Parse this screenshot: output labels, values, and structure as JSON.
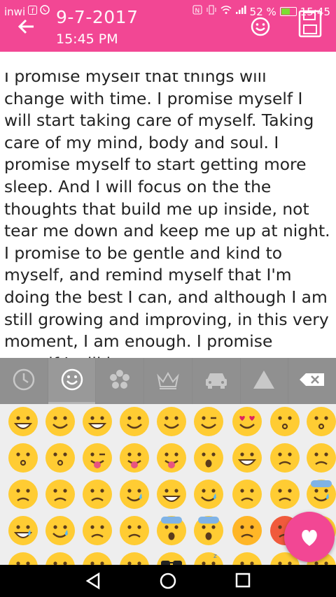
{
  "status_bar": {
    "carrier": "inwi",
    "battery": "52 %",
    "time": "15:45",
    "icons": [
      "facebook-icon",
      "whatsapp-icon",
      "nfc-icon",
      "vibrate-icon",
      "wifi-icon",
      "signal-icon",
      "battery-icon"
    ]
  },
  "header": {
    "date": "9-7-2017",
    "time": "15:45 PM",
    "back_icon": "back-arrow-icon",
    "emoji_icon": "smiley-icon",
    "save_icon": "save-icon",
    "color": "#f24794"
  },
  "note": {
    "text": "I promise myself that things will change with time. I promise myself I will start taking care of myself. Taking care of my mind, body and soul. I promise myself to start getting more sleep. And I will focus on the the thoughts that build me up inside, not tear me down and keep me up at night. I promise to be gentle and kind to myself, and remind myself that I'm doing the best I can, and although I am still growing and improving, in this very moment, I am enough. I promise myself I will keep"
  },
  "keyboard": {
    "tabs": [
      "recent-icon",
      "smileys-icon",
      "flower-icon",
      "crown-icon",
      "car-icon",
      "symbols-triangle-icon",
      "backspace-icon"
    ],
    "active_tab": 1,
    "emoji_rows": [
      [
        "grin",
        "smiley",
        "grinning",
        "blush",
        "relaxed",
        "wink",
        "heart-eyes",
        "kissing-heart",
        "kissing-closed-eyes"
      ],
      [
        "kissing",
        "kissing-smiling-eyes",
        "stuck-out-tongue-winking-eye",
        "stuck-out-tongue-closed-eyes",
        "stuck-out-tongue",
        "flushed",
        "grimacing",
        "pensive",
        "relieved"
      ],
      [
        "unamused",
        "disappointed",
        "persevere",
        "cry",
        "joy",
        "sob",
        "sleepy",
        "disappointed-relieved",
        "cold-sweat"
      ],
      [
        "sweat-smile",
        "sweat",
        "weary",
        "tired-face",
        "fearful",
        "scream",
        "angry",
        "rage",
        "triumph"
      ],
      [
        "confounded",
        "laughing",
        "yum",
        "mask",
        "sunglasses",
        "sleeping",
        "dizzy-face",
        "astonished",
        "worried"
      ]
    ]
  },
  "fab": {
    "icon": "heart-icon"
  },
  "nav": {
    "icons": [
      "back-triangle-icon",
      "home-circle-icon",
      "recents-square-icon"
    ]
  }
}
